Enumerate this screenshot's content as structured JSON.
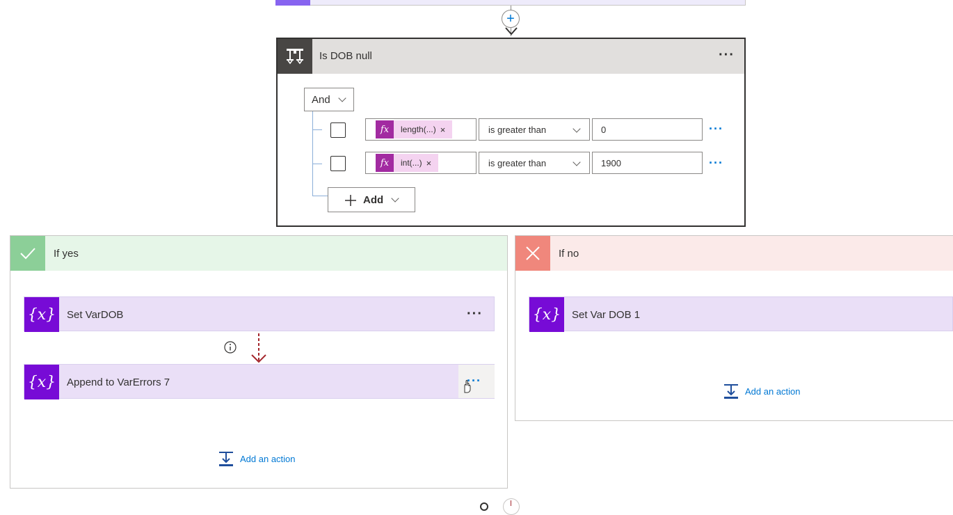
{
  "condition": {
    "title": "Is DOB null",
    "group_operator": "And",
    "rows": [
      {
        "token_label": "length(...)",
        "token_remove": "×",
        "operator": "is greater than",
        "value": "0"
      },
      {
        "token_label": "int(...)",
        "token_remove": "×",
        "operator": "is greater than",
        "value": "1900"
      }
    ],
    "add_label": "Add",
    "more_options": "···"
  },
  "branches": {
    "yes": {
      "title": "If yes",
      "actions": [
        {
          "title": "Set VarDOB"
        },
        {
          "title": "Append to VarErrors 7"
        }
      ],
      "add_action_label": "Add an action"
    },
    "no": {
      "title": "If no",
      "actions": [
        {
          "title": "Set Var DOB 1"
        }
      ],
      "add_action_label": "Add an action"
    }
  },
  "icons": {
    "condition": "condition-icon",
    "variable": "variable-icon",
    "yes": "check-icon",
    "no": "close-icon",
    "token": "fx-icon"
  },
  "colors": {
    "variable_accent": "#770bd6",
    "variable_bg": "#eadff7",
    "yes_bg": "#e6f6e8",
    "yes_accent": "#8ccf98",
    "no_bg": "#fbeae9",
    "no_accent": "#f0877c",
    "expression_accent": "#a22ba1",
    "link_blue": "#0078d4"
  }
}
